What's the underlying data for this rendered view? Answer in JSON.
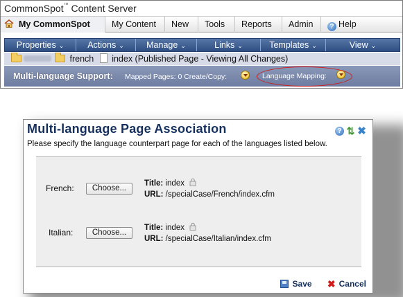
{
  "app": {
    "brand": "CommonSpot",
    "tm": "™",
    "product": " Content Server"
  },
  "nav": {
    "home": "My CommonSpot",
    "items": [
      "My Content",
      "New",
      "Tools",
      "Reports",
      "Admin",
      "Help"
    ]
  },
  "menubar": [
    "Properties",
    "Actions",
    "Manage",
    "Links",
    "Templates",
    "View"
  ],
  "breadcrumb": {
    "folder": "french",
    "page": "index (Published Page - Viewing All Changes)"
  },
  "mls_bar": {
    "label": "Multi-language Support:",
    "mapped": "Mapped Pages: 0 Create/Copy:",
    "mapping": "Language Mapping:"
  },
  "dialog": {
    "title": "Multi-language Page Association",
    "description": "Please specify the language counterpart page for each of the languages listed below.",
    "rows": [
      {
        "language": "French:",
        "button": "Choose...",
        "title_label": "Title:",
        "title_value": "index",
        "url_label": "URL:",
        "url_value": "/specialCase/French/index.cfm"
      },
      {
        "language": "Italian:",
        "button": "Choose...",
        "title_label": "Title:",
        "title_value": "index",
        "url_label": "URL:",
        "url_value": "/specialCase/Italian/index.cfm"
      }
    ],
    "save": "Save",
    "cancel": "Cancel"
  },
  "colors": {
    "menubar": "#3a5a8e",
    "mls_bar": "#7a88ab",
    "title_text": "#16305e",
    "highlight": "#d11a1a"
  }
}
